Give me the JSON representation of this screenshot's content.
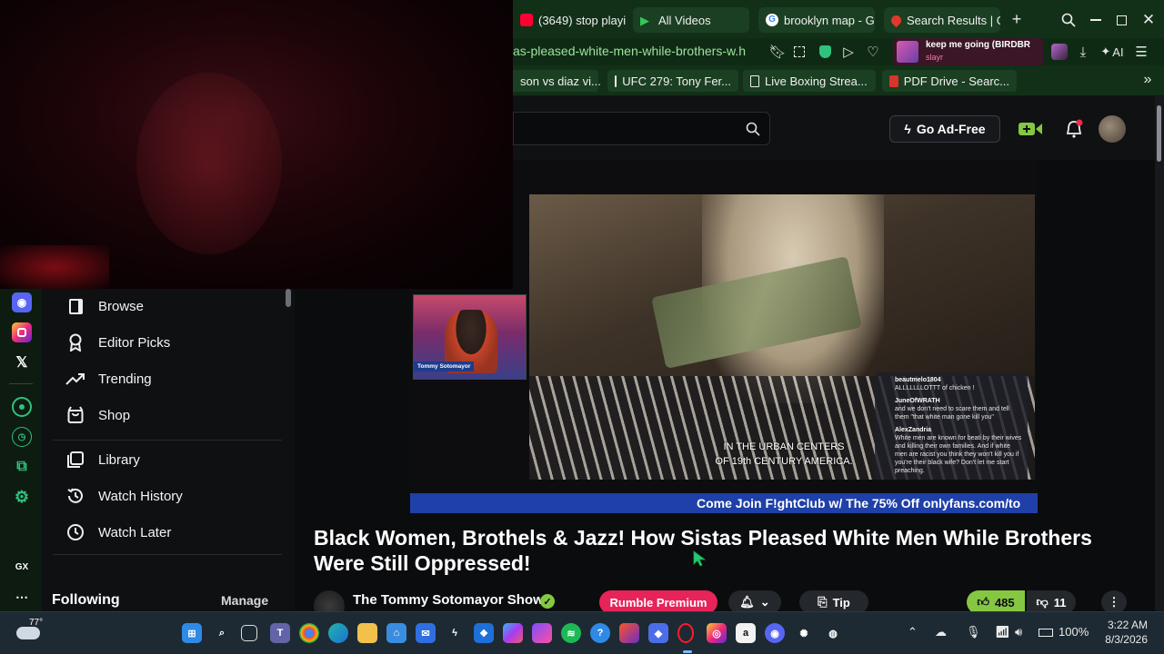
{
  "browser": {
    "tabs": [
      {
        "label": "(3649) stop playi",
        "icon": "youtube-icon",
        "color": "#ff0033"
      },
      {
        "label": "All Videos",
        "icon": "play-icon",
        "color": "#34c759"
      },
      {
        "label": "brooklyn map - G",
        "icon": "google-icon",
        "color": "#ffffff"
      },
      {
        "label": "Search Results | G",
        "icon": "location-pin-icon",
        "color": "#e0382b"
      }
    ],
    "new_tab_symbol": "+",
    "address": "as-pleased-white-men-while-brothers-w.h",
    "music_title": "keep me going (BIRDBR",
    "music_artist": "slayr",
    "ai_label": "AI",
    "bookmarks": [
      {
        "label": "son vs diaz vi..."
      },
      {
        "label": "UFC 279: Tony Fer..."
      },
      {
        "label": "Live Boxing Strea..."
      },
      {
        "label": "PDF Drive - Searc..."
      }
    ]
  },
  "header": {
    "go_ad_free": "Go Ad-Free",
    "accent": "#85c742"
  },
  "sidebar": {
    "items": [
      {
        "label": "Browse",
        "icon": "browse-icon"
      },
      {
        "label": "Editor Picks",
        "icon": "ribbon-icon"
      },
      {
        "label": "Trending",
        "icon": "trending-icon"
      },
      {
        "label": "Shop",
        "icon": "shopping-bag-icon"
      },
      {
        "label": "Library",
        "icon": "library-icon"
      },
      {
        "label": "Watch History",
        "icon": "history-icon"
      },
      {
        "label": "Watch Later",
        "icon": "clock-icon"
      }
    ],
    "following_label": "Following",
    "manage_label": "Manage",
    "rail_gx": "GX"
  },
  "video": {
    "caption_line1": "IN THE URBAN CENTERS",
    "caption_line2": "OF 19th CENTURY AMERICA.",
    "pip_name": "Tommy Sotomayor",
    "chat": [
      {
        "user": "beautmelo1804",
        "text": "ALLLLLLLOTTT of chicken !"
      },
      {
        "user": "JuneOfWRATH",
        "text": "and we don't need to scare them and tell them \"that white man gone kill you\""
      },
      {
        "user": "AlexZandria",
        "text": "White men are known for beati by their wives and killing their own families. And if white men are racist you think they won't kill you if you're their black wife? Don't let me start preaching."
      }
    ],
    "banner": "Come Join F!ghtClub w/ The 75% Off onlyfans.com/to",
    "title": "Black Women, Brothels & Jazz! How Sistas Pleased White Men While Brothers Were Still Oppressed!",
    "channel": "The Tommy Sotomayor Show",
    "premium_label": "Rumble Premium",
    "tip_label": "Tip",
    "likes": "485",
    "dislikes": "11"
  },
  "taskbar": {
    "temperature": "77°",
    "battery": "100%",
    "time": "3:22 AM",
    "date": "8/3/2026"
  }
}
